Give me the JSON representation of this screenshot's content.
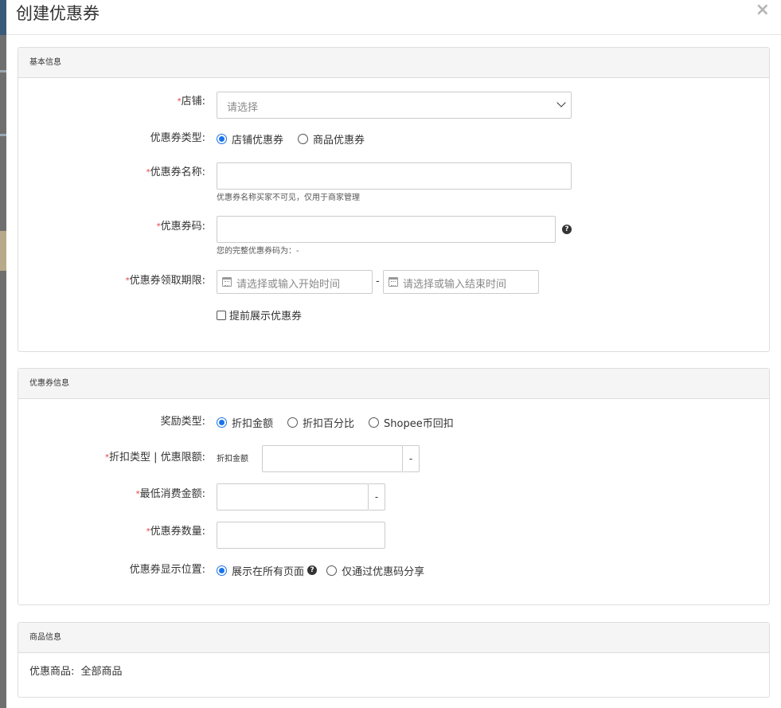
{
  "modal": {
    "title": "创建优惠券",
    "close_label": "×"
  },
  "basic": {
    "heading": "基本信息",
    "store": {
      "label": "店铺:",
      "placeholder": "请选择"
    },
    "coupon_type": {
      "label": "优惠券类型:",
      "options": [
        "店铺优惠券",
        "商品优惠券"
      ],
      "selected": 0
    },
    "coupon_name": {
      "label": "优惠券名称:",
      "value": "",
      "help": "优惠券名称买家不可见，仅用于商家管理"
    },
    "coupon_code": {
      "label": "优惠券码:",
      "value": "",
      "help": "您的完整优惠券码为：-"
    },
    "period": {
      "label": "优惠券领取期限:",
      "start_placeholder": "请选择或输入开始时间",
      "separator": "-",
      "end_placeholder": "请选择或输入结束时间"
    },
    "early_display": {
      "label": "提前展示优惠券",
      "checked": false
    }
  },
  "coupon_info": {
    "heading": "优惠券信息",
    "reward_type": {
      "label": "奖励类型:",
      "options": [
        "折扣金额",
        "折扣百分比",
        "Shopee币回扣"
      ],
      "selected": 0
    },
    "discount_limit": {
      "label": "折扣类型 | 优惠限额:",
      "prefix": "折扣金额",
      "value": "",
      "suffix": "-"
    },
    "min_spend": {
      "label": "最低消费金额:",
      "value": "",
      "suffix": "-"
    },
    "quantity": {
      "label": "优惠券数量:",
      "value": ""
    },
    "display_position": {
      "label": "优惠券显示位置:",
      "options": [
        "展示在所有页面",
        "仅通过优惠码分享"
      ],
      "selected": 0
    }
  },
  "product_info": {
    "heading": "商品信息",
    "label": "优惠商品:",
    "value": "全部商品"
  },
  "colors": {
    "accent": "#1a73e8",
    "required": "#e63a3a",
    "panel_header": "#f5f5f5",
    "border": "#dddddd"
  }
}
